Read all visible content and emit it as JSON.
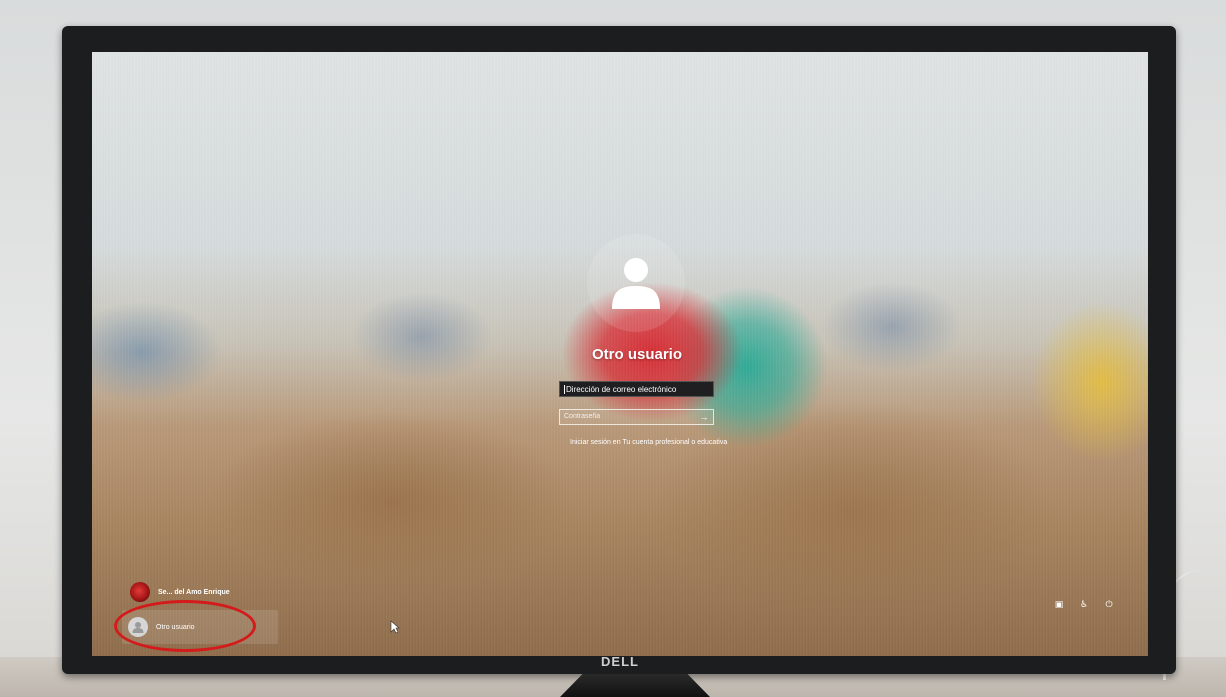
{
  "login": {
    "title": "Otro usuario",
    "email_placeholder": "Dirección de correo electrónico",
    "password_placeholder": "Contraseña",
    "submit_icon": "arrow-right-icon",
    "signin_link": "Iniciar sesión en Tu cuenta profesional o educativa"
  },
  "users": [
    {
      "name": "Se... del Amo Enrique",
      "icon": "user-photo"
    },
    {
      "name": "Otro usuario",
      "icon": "generic-user-icon"
    }
  ],
  "system_icons": [
    "network-icon",
    "accessibility-icon",
    "power-icon"
  ],
  "monitor": {
    "brand": "DELL"
  },
  "colors": {
    "highlight_circle": "#d31b1b",
    "input_bg": "#1f1f22"
  }
}
